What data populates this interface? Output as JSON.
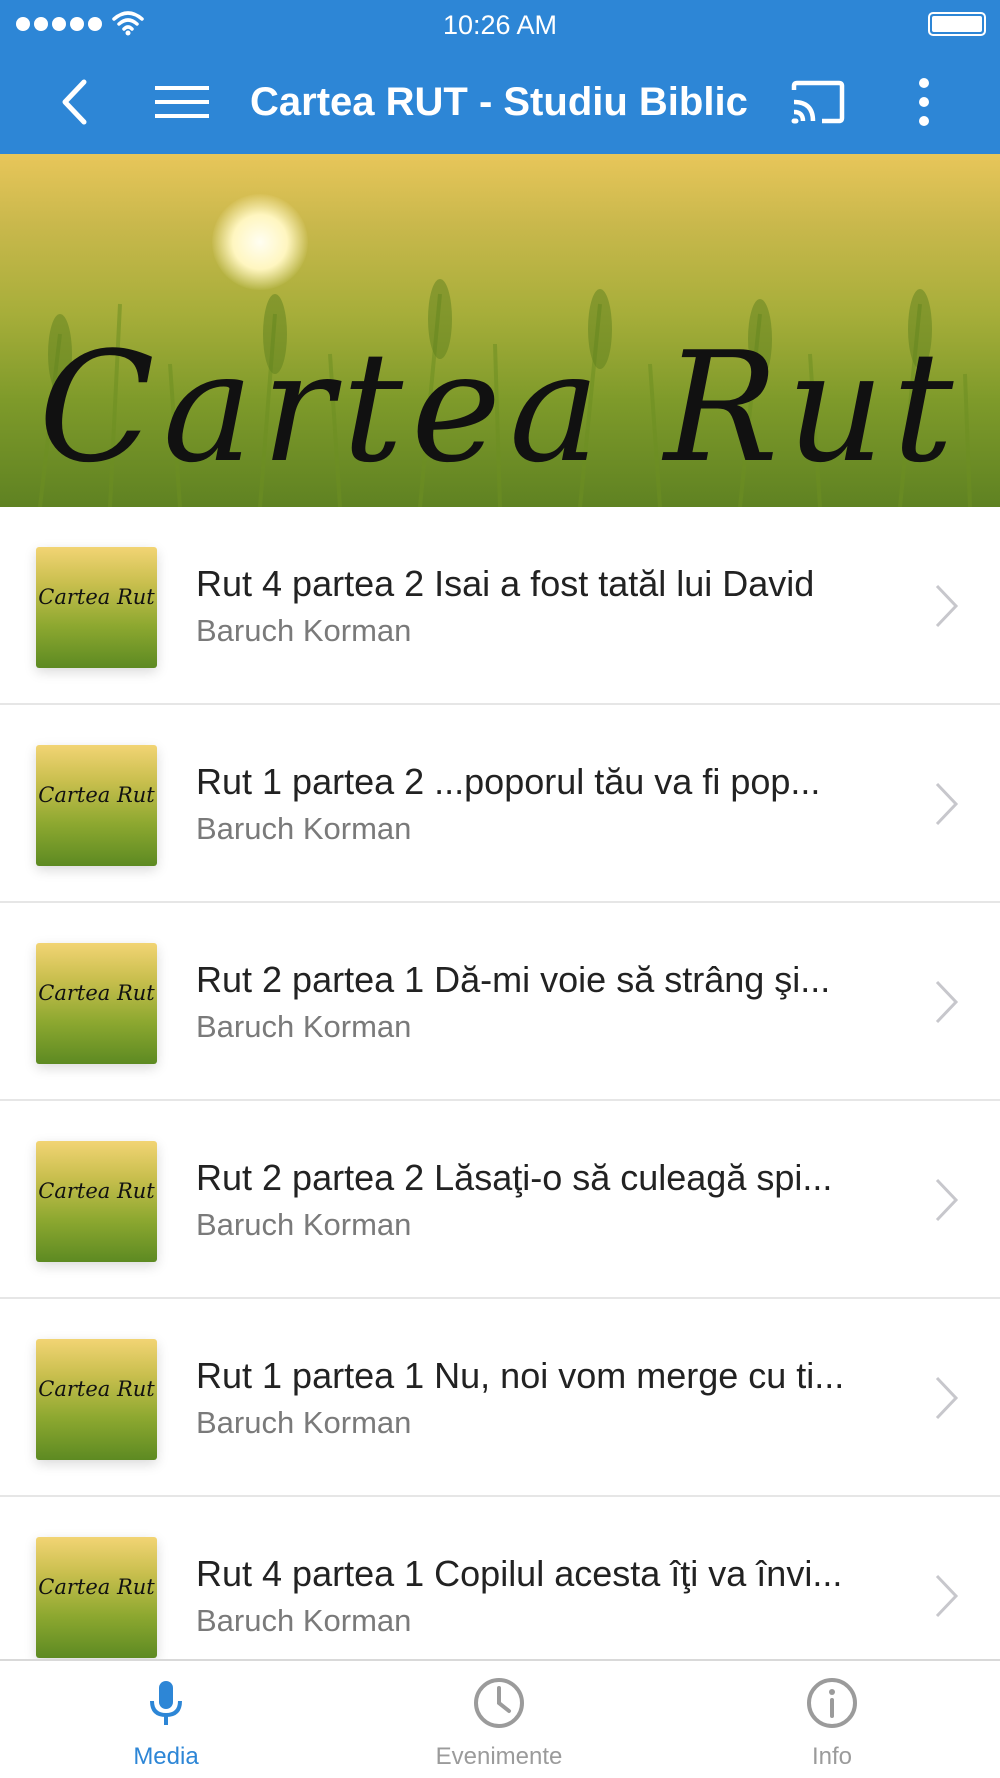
{
  "status_bar": {
    "time": "10:26 AM"
  },
  "app_bar": {
    "title": "Cartea RUT - Studiu Biblic",
    "icons": [
      "back-icon",
      "menu-icon",
      "cast-icon",
      "more-vert-icon"
    ]
  },
  "banner": {
    "title": "Cartea Rut"
  },
  "media_list": {
    "thumbnail_text": "Cartea Rut",
    "items": [
      {
        "title": "Rut 4 partea 2 Isai a fost tatăl lui David",
        "subtitle": "Baruch Korman"
      },
      {
        "title": "Rut 1 partea 2 ...poporul tău va fi pop...",
        "subtitle": "Baruch Korman"
      },
      {
        "title": "Rut 2 partea 1 Dă-mi voie să strâng şi...",
        "subtitle": "Baruch Korman"
      },
      {
        "title": "Rut 2 partea 2 Lăsaţi-o să culeagă spi...",
        "subtitle": "Baruch Korman"
      },
      {
        "title": "Rut 1 partea 1 Nu, noi vom merge cu ti...",
        "subtitle": "Baruch Korman"
      },
      {
        "title": "Rut 4 partea 1 Copilul acesta îţi va învi...",
        "subtitle": "Baruch Korman"
      }
    ]
  },
  "tab_bar": {
    "tabs": [
      {
        "label": "Media",
        "icon": "microphone-icon",
        "active": true
      },
      {
        "label": "Evenimente",
        "icon": "clock-icon",
        "active": false
      },
      {
        "label": "Info",
        "icon": "info-icon",
        "active": false
      }
    ]
  },
  "colors": {
    "primary": "#2d86d6",
    "tab_active": "#2d86d6",
    "tab_inactive": "#9b9b9b",
    "title_text": "#222222",
    "subtitle_text": "#7a7a7a"
  }
}
